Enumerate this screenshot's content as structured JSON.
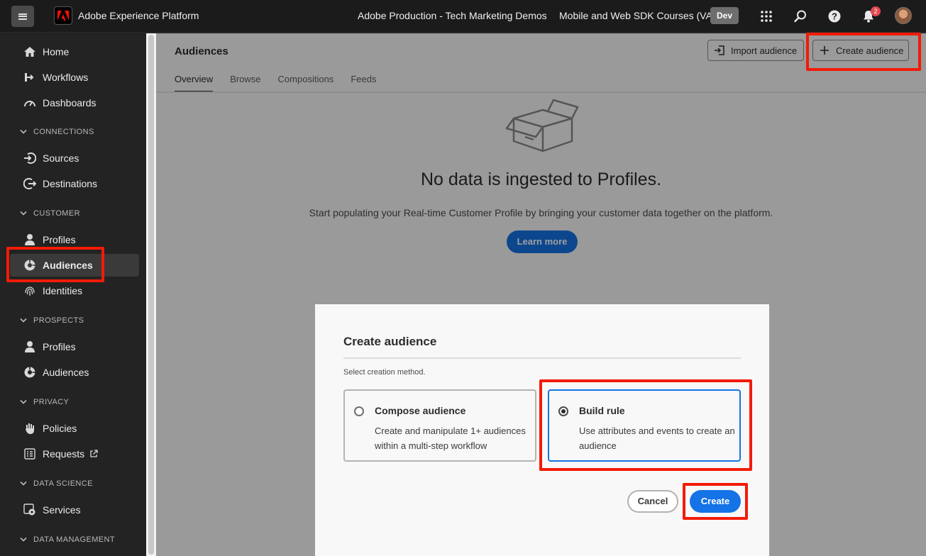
{
  "topbar": {
    "app_title": "Adobe Experience Platform",
    "org_name": "Adobe Production - Tech Marketing Demos",
    "sandbox_name": "Mobile and Web SDK Courses (VA7)",
    "env_badge": "Dev",
    "notification_count": "2"
  },
  "sidebar": {
    "items": {
      "home": "Home",
      "workflows": "Workflows",
      "dashboards": "Dashboards",
      "sources": "Sources",
      "destinations": "Destinations",
      "profiles": "Profiles",
      "audiences": "Audiences",
      "identities": "Identities",
      "prospect_profiles": "Profiles",
      "prospect_audiences": "Audiences",
      "policies": "Policies",
      "requests": "Requests",
      "services": "Services"
    },
    "sections": {
      "connections": "CONNECTIONS",
      "customer": "CUSTOMER",
      "prospects": "PROSPECTS",
      "privacy": "PRIVACY",
      "data_science": "DATA SCIENCE",
      "data_management": "DATA MANAGEMENT"
    }
  },
  "page": {
    "title": "Audiences",
    "import_label": "Import audience",
    "create_label": "Create audience",
    "tabs": [
      "Overview",
      "Browse",
      "Compositions",
      "Feeds"
    ],
    "empty_title": "No data is ingested to Profiles.",
    "empty_sub": "Start populating your Real-time Customer Profile by bringing your customer data together on the platform.",
    "learn_more": "Learn more"
  },
  "modal": {
    "title": "Create audience",
    "label": "Select creation method.",
    "options": [
      {
        "title": "Compose audience",
        "desc": "Create and manipulate 1+ audiences within a multi-step workflow",
        "selected": false
      },
      {
        "title": "Build rule",
        "desc": "Use attributes and events to create an audience",
        "selected": true
      }
    ],
    "cancel": "Cancel",
    "create": "Create"
  },
  "colors": {
    "accent": "#1473e6",
    "annotation": "#f21b07",
    "sidebar_bg": "#232323"
  }
}
